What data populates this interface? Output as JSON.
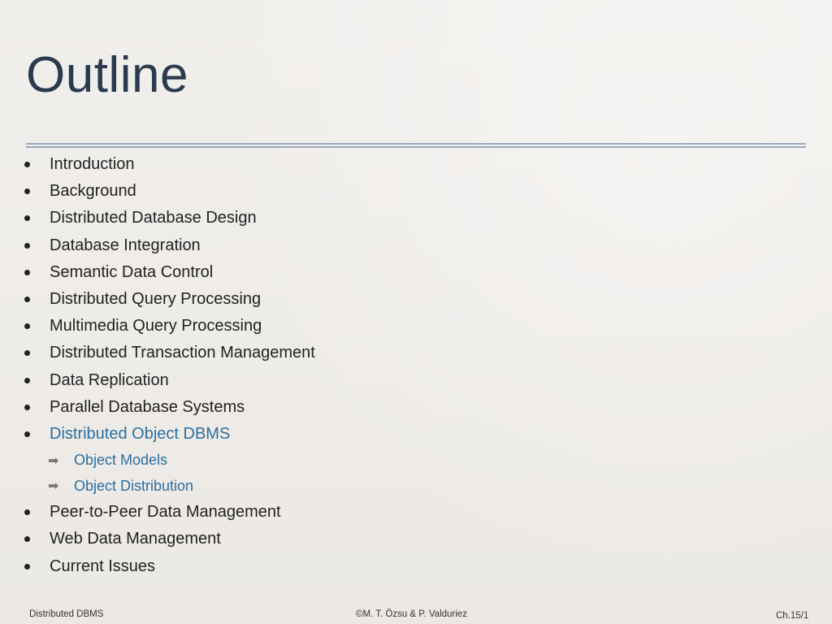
{
  "slide": {
    "title": "Outline",
    "items": [
      "Introduction",
      "Background",
      "Distributed Database Design",
      "Database Integration",
      "Semantic Data Control",
      "Distributed Query Processing",
      "Multimedia Query Processing",
      "Distributed Transaction Management",
      "Data Replication",
      "Parallel Database Systems",
      "Distributed Object DBMS"
    ],
    "subitems": [
      "Object Models",
      "Object Distribution"
    ],
    "items_after": [
      "Peer-to-Peer Data Management",
      "Web Data Management",
      "Current Issues"
    ],
    "sub_arrow": "➡",
    "highlight_color": "#2a6fa1"
  },
  "footer": {
    "left": "Distributed DBMS",
    "center": "©M. T. Özsu & P. Valduriez",
    "right": "Ch.15/1"
  }
}
